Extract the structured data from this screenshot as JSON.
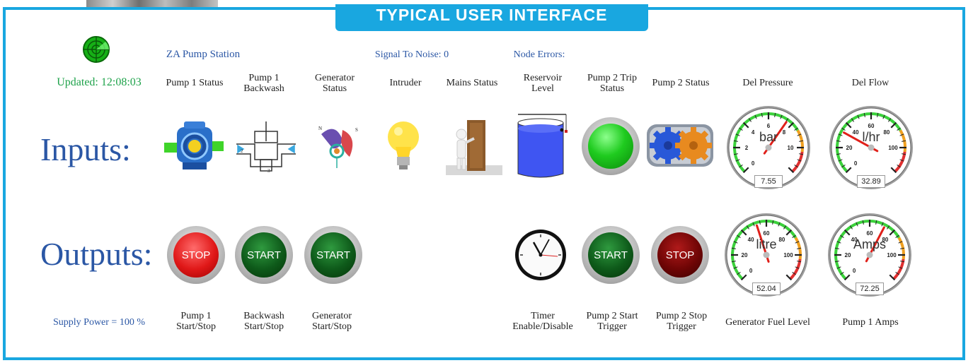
{
  "banner": {
    "title": "TYPICAL USER INTERFACE"
  },
  "header": {
    "station": "ZA Pump Station",
    "signal": "Signal To Noise: 0",
    "node_errors": "Node Errors:",
    "updated": "Updated: 12:08:03"
  },
  "section_labels": {
    "inputs": "Inputs:",
    "outputs": "Outputs:"
  },
  "inputs": [
    {
      "label": "Pump 1 Status"
    },
    {
      "label": "Pump 1\nBackwash"
    },
    {
      "label": "Generator\nStatus"
    },
    {
      "label": "Intruder"
    },
    {
      "label": "Mains Status"
    },
    {
      "label": "Reservoir\nLevel"
    },
    {
      "label": "Pump 2 Trip\nStatus"
    },
    {
      "label": "Pump 2 Status"
    },
    {
      "label": "Del Pressure"
    },
    {
      "label": "Del Flow"
    }
  ],
  "gauges": {
    "del_pressure": {
      "unit": "bar",
      "value": "7.55",
      "ticks": [
        "0",
        "2",
        "4",
        "6",
        "8",
        "10"
      ],
      "max": 12
    },
    "del_flow": {
      "unit": "l/hr",
      "value": "32.89",
      "ticks": [
        "0",
        "20",
        "40",
        "60",
        "80",
        "100"
      ],
      "max": 120
    },
    "gen_fuel": {
      "unit": "litre",
      "value": "52.04",
      "ticks": [
        "0",
        "20",
        "40",
        "60",
        "80",
        "100"
      ],
      "max": 120
    },
    "pump1_amps": {
      "unit": "Amps",
      "value": "72.25",
      "ticks": [
        "0",
        "20",
        "40",
        "60",
        "80",
        "100"
      ],
      "max": 120
    }
  },
  "buttons": {
    "pump1": "STOP",
    "backwash": "START",
    "generator": "START",
    "pump2_start": "START",
    "pump2_stop": "STOP"
  },
  "outputs": {
    "supply_power": "Supply Power = 100 %",
    "pump1": "Pump 1\nStart/Stop",
    "backwash": "Backwash\nStart/Stop",
    "generator": "Generator\nStart/Stop",
    "timer": "Timer\nEnable/Disable",
    "pump2_start": "Pump 2 Start\nTrigger",
    "pump2_stop": "Pump 2 Stop\nTrigger",
    "gen_fuel": "Generator Fuel Level",
    "pump1_amps": "Pump 1 Amps"
  },
  "colors": {
    "accent": "#19a7e0",
    "title_blue": "#2b57a5",
    "updated_green": "#1ea24a"
  }
}
